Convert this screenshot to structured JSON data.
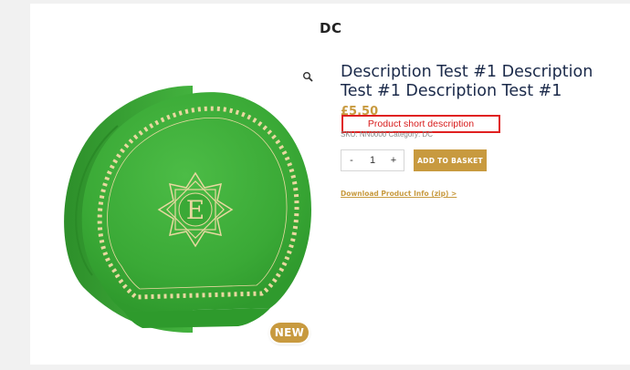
{
  "site": {
    "brand": "DC"
  },
  "gallery": {
    "badge": "NEW",
    "zoom_icon": "magnifier-icon",
    "product_color": "#3daa3a",
    "accent_color": "#e9d8a0"
  },
  "product": {
    "title": "Description Test #1 Description Test #1 Description Test #1",
    "price": "£5.50",
    "short_description": "Product short description",
    "sku_label": "SKU:",
    "sku": "NN0000",
    "category_label": "Category:",
    "category": "DC"
  },
  "cart": {
    "minus": "-",
    "quantity": "1",
    "plus": "+",
    "add_to_basket": "ADD TO BASKET"
  },
  "links": {
    "download": "Download Product Info (zip) >"
  },
  "colors": {
    "accent": "#c89a3f",
    "title": "#1b2a4a",
    "highlight": "#e02020"
  }
}
